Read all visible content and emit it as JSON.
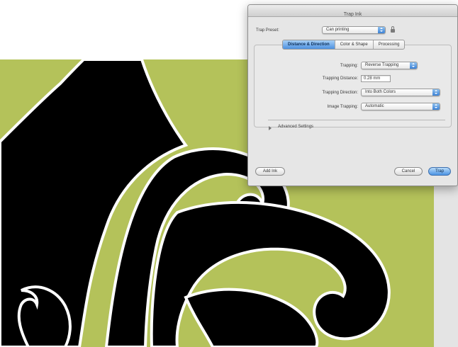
{
  "colors": {
    "artwork_green": "#b4c25a",
    "artwork_black": "#000000",
    "artwork_outline": "#ffffff",
    "canvas_gray": "#e4e4e4",
    "accent_blue": "#4a93e3"
  },
  "dialog": {
    "title": "Trap Ink",
    "preset": {
      "label": "Trap Preset:",
      "value": "Can printing",
      "lock_icon": "lock-icon"
    },
    "tabs": [
      {
        "label": "Distance & Direction",
        "active": true
      },
      {
        "label": "Color & Shape",
        "active": false
      },
      {
        "label": "Processing",
        "active": false
      }
    ],
    "settings": {
      "trapping": {
        "label": "Trapping:",
        "value": "Reverse Trapping"
      },
      "trapping_distance": {
        "label": "Trapping Distance:",
        "value": "0.28 mm"
      },
      "trapping_direction": {
        "label": "Trapping Direction:",
        "value": "Into Both Colors"
      },
      "image_trapping": {
        "label": "Image Trapping:",
        "value": "Automatic"
      }
    },
    "advanced": {
      "label": "Advanced Settings",
      "icon": "disclosure-triangle-icon"
    },
    "buttons": {
      "add_ink": "Add Ink",
      "cancel": "Cancel",
      "ok": "Trap"
    }
  }
}
